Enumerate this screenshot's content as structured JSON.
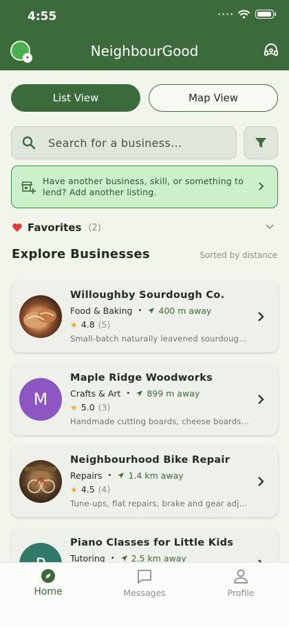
{
  "status_bar": {
    "time": "4:55"
  },
  "header": {
    "title": "NeighbourGood"
  },
  "view_toggle": {
    "list_label": "List View",
    "map_label": "Map View",
    "selected": "List View"
  },
  "search": {
    "placeholder": "Search for a business..."
  },
  "banner": {
    "text": "Have another business, skill, or something to lend? Add another listing."
  },
  "favorites": {
    "label": "Favorites",
    "count": "(2)"
  },
  "explore": {
    "title": "Explore Businesses",
    "sort_note": "Sorted by distance"
  },
  "businesses": [
    {
      "name": "Willoughby Sourdough Co.",
      "category": "Food & Baking",
      "distance": "400 m away",
      "rating": "4.8",
      "reviews": "(5)",
      "description": "Small-batch naturally leavened sourdough bread",
      "avatar": "photo-bread"
    },
    {
      "name": "Maple Ridge Woodworks",
      "category": "Crafts & Art",
      "distance": "899 m away",
      "rating": "5.0",
      "reviews": "(3)",
      "description": "Handmade cutting boards, cheese boards and more",
      "avatar_letter": "M",
      "avatar_color": "#8e56c3"
    },
    {
      "name": "Neighbourhood Bike Repair",
      "category": "Repairs",
      "distance": "1.4 km away",
      "rating": "4.5",
      "reviews": "(4)",
      "description": "Tune-ups, flat repairs, brake and gear adjustments",
      "avatar": "photo-bike-shop"
    },
    {
      "name": "Piano Classes for Little Kids",
      "category": "Tutoring",
      "distance": "2.5 km away",
      "avatar_letter": "P",
      "avatar_color": "#2f7a68"
    }
  ],
  "bottom_nav": {
    "home": "Home",
    "messages": "Messages",
    "profile": "Profile",
    "active": "Home"
  },
  "colors": {
    "brand": "#3b6b3a",
    "background": "#f1f5ec",
    "banner": "#ccf0c9",
    "star": "#f5a623"
  }
}
